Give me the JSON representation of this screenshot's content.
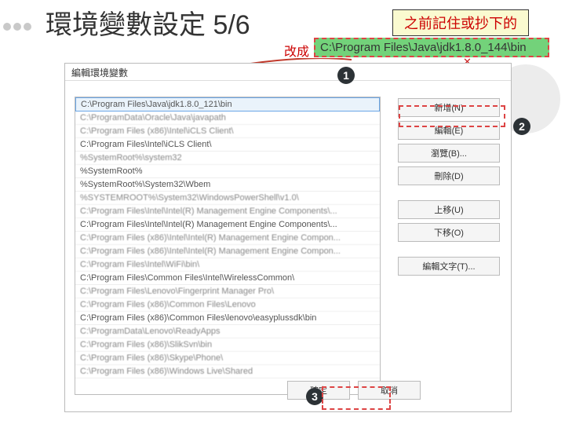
{
  "slide_title": "環境變數設定 5/6",
  "reminder": "之前記住或抄下的",
  "change_label": "改成",
  "target_path": "C:\\Program Files\\Java\\jdk1.8.0_144\\bin",
  "dialog_title": "編輯環境變數",
  "callouts": {
    "one": "1",
    "two": "2",
    "three": "3"
  },
  "paths": [
    "C:\\Program Files\\Java\\jdk1.8.0_121\\bin",
    "C:\\ProgramData\\Oracle\\Java\\javapath",
    "C:\\Program Files (x86)\\Intel\\iCLS Client\\",
    "C:\\Program Files\\Intel\\iCLS Client\\",
    "%SystemRoot%\\system32",
    "%SystemRoot%",
    "%SystemRoot%\\System32\\Wbem",
    "%SYSTEMROOT%\\System32\\WindowsPowerShell\\v1.0\\",
    "C:\\Program Files\\Intel\\Intel(R) Management Engine Components\\...",
    "C:\\Program Files\\Intel\\Intel(R) Management Engine Components\\...",
    "C:\\Program Files (x86)\\Intel\\Intel(R) Management Engine Compon...",
    "C:\\Program Files (x86)\\Intel\\Intel(R) Management Engine Compon...",
    "C:\\Program Files\\Intel\\WiFi\\bin\\",
    "C:\\Program Files\\Common Files\\Intel\\WirelessCommon\\",
    "C:\\Program Files\\Lenovo\\Fingerprint Manager Pro\\",
    "C:\\Program Files (x86)\\Common Files\\Lenovo",
    "C:\\Program Files (x86)\\Common Files\\lenovo\\easyplussdk\\bin",
    "C:\\ProgramData\\Lenovo\\ReadyApps",
    "C:\\Program Files (x86)\\SlikSvn\\bin",
    "C:\\Program Files (x86)\\Skype\\Phone\\",
    "C:\\Program Files (x86)\\Windows Live\\Shared"
  ],
  "buttons": {
    "new": "新增(N)",
    "edit": "編輯(E)",
    "browse": "瀏覽(B)...",
    "delete": "刪除(D)",
    "up": "上移(U)",
    "down": "下移(O)",
    "edit_text": "編輯文字(T)...",
    "ok": "確定",
    "cancel": "取消"
  }
}
